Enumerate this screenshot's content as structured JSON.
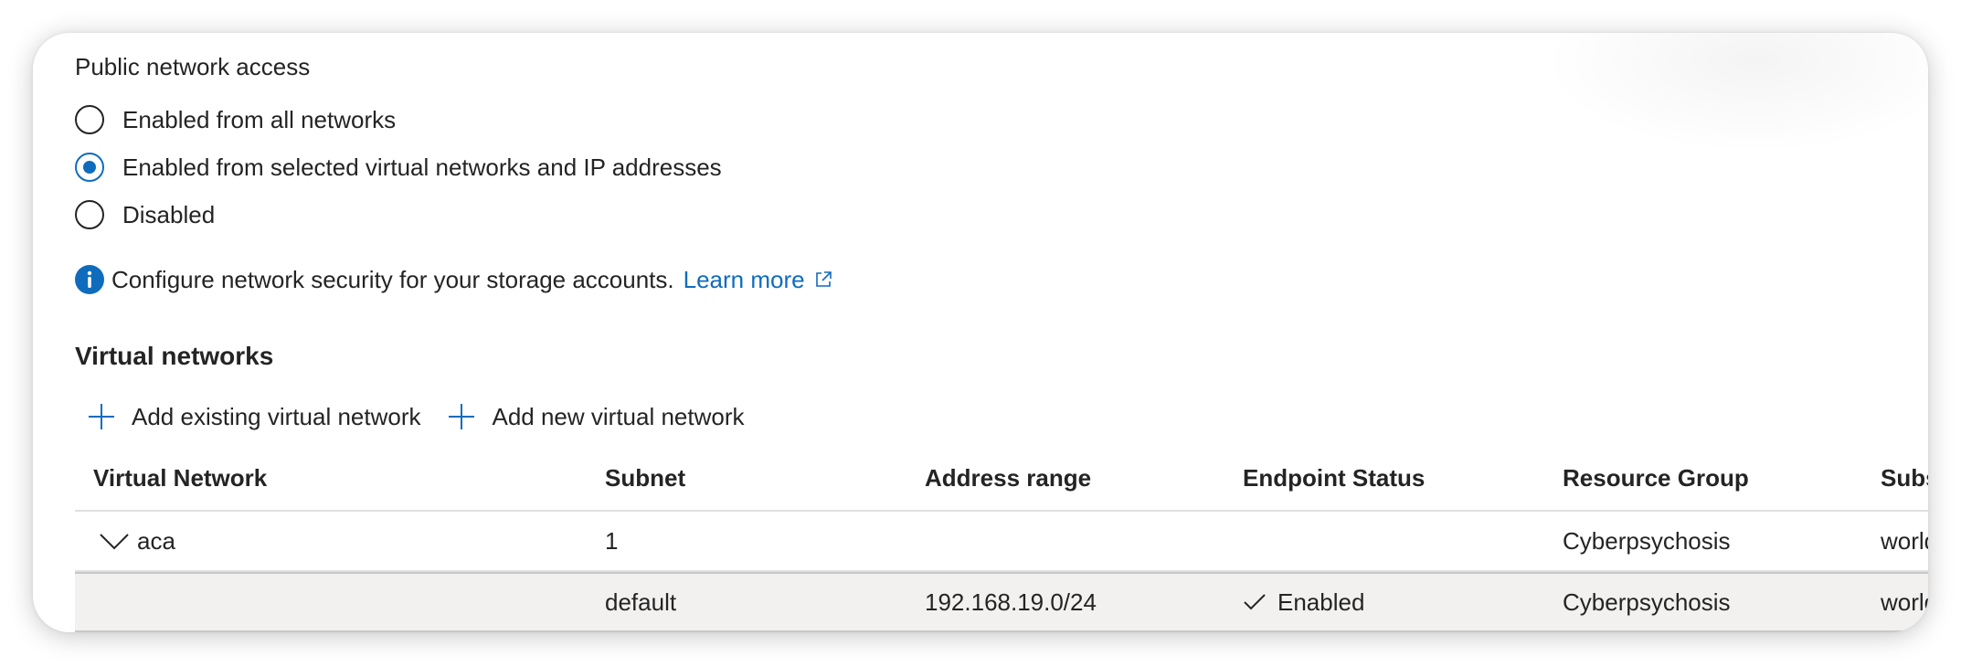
{
  "public_network_access": {
    "label": "Public network access",
    "options": [
      {
        "label": "Enabled from all networks",
        "selected": false
      },
      {
        "label": "Enabled from selected virtual networks and IP addresses",
        "selected": true
      },
      {
        "label": "Disabled",
        "selected": false
      }
    ]
  },
  "info": {
    "text": "Configure network security for your storage accounts.",
    "link_label": "Learn more",
    "icon": "info-icon",
    "link_icon": "external-link-icon"
  },
  "virtual_networks": {
    "heading": "Virtual networks",
    "toolbar": {
      "add_existing_label": "Add existing virtual network",
      "add_new_label": "Add new virtual network"
    },
    "columns": [
      "Virtual Network",
      "Subnet",
      "Address range",
      "Endpoint Status",
      "Resource Group",
      "Subscription"
    ],
    "rows": [
      {
        "virtual_network": "aca",
        "subnet": "1",
        "address_range": "",
        "endpoint_status": "",
        "resource_group": "Cyberpsychosis",
        "subscription": "world",
        "expanded": true
      },
      {
        "virtual_network": "",
        "subnet": "default",
        "address_range": "192.168.19.0/24",
        "endpoint_status": "Enabled",
        "resource_group": "Cyberpsychosis",
        "subscription": "world"
      }
    ]
  },
  "colors": {
    "accent": "#0f6cbd",
    "text": "#242424",
    "child_row_bg": "#f2f1f0"
  }
}
